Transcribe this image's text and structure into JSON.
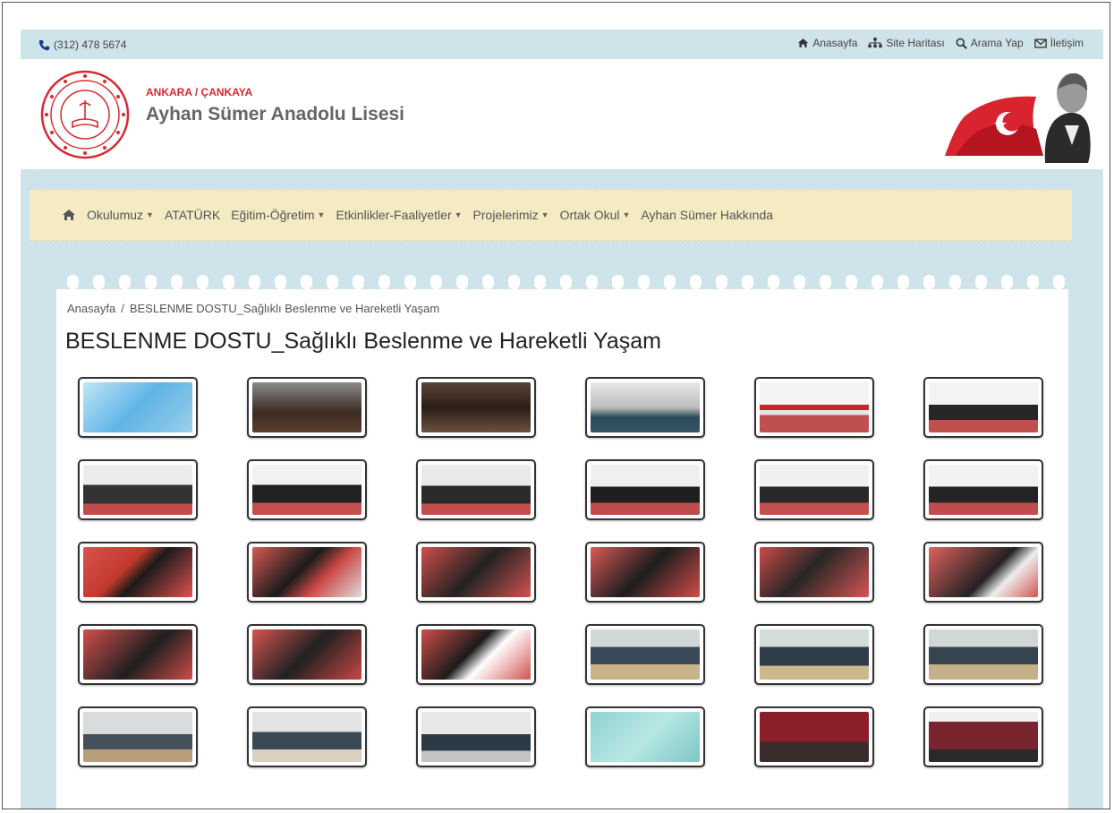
{
  "topbar": {
    "phone": "(312) 478 5674",
    "links": [
      "Anasayfa",
      "Site Haritası",
      "Arama Yap",
      "İletişim"
    ]
  },
  "school": {
    "city": "ANKARA / ÇANKAYA",
    "name": "Ayhan Sümer Anadolu Lisesi"
  },
  "nav": {
    "items": [
      {
        "label": "Okulumuz",
        "dropdown": true
      },
      {
        "label": "ATATÜRK",
        "dropdown": false
      },
      {
        "label": "Eğitim-Öğretim",
        "dropdown": true
      },
      {
        "label": "Etkinlikler-Faaliyetler",
        "dropdown": true
      },
      {
        "label": "Projelerimiz",
        "dropdown": true
      },
      {
        "label": "Ortak Okul",
        "dropdown": true
      },
      {
        "label": "Ayhan Sümer Hakkında",
        "dropdown": false
      }
    ]
  },
  "breadcrumb": {
    "home": "Anasayfa",
    "separator": "/",
    "current": "BESLENME DOSTU_Sağlıklı Beslenme ve Hareketli Yaşam"
  },
  "page_title": "BESLENME DOSTU_Sağlıklı Beslenme ve Hareketli Yaşam",
  "colors": {
    "accent_red": "#d52b32",
    "page_blue": "#cfe3ea",
    "nav_cream": "#f4ebc3"
  },
  "icons": [
    "phone-icon",
    "home-icon",
    "sitemap-icon",
    "search-icon",
    "envelope-icon"
  ],
  "gallery": {
    "count": 30,
    "columns": 6,
    "rows": 5
  }
}
